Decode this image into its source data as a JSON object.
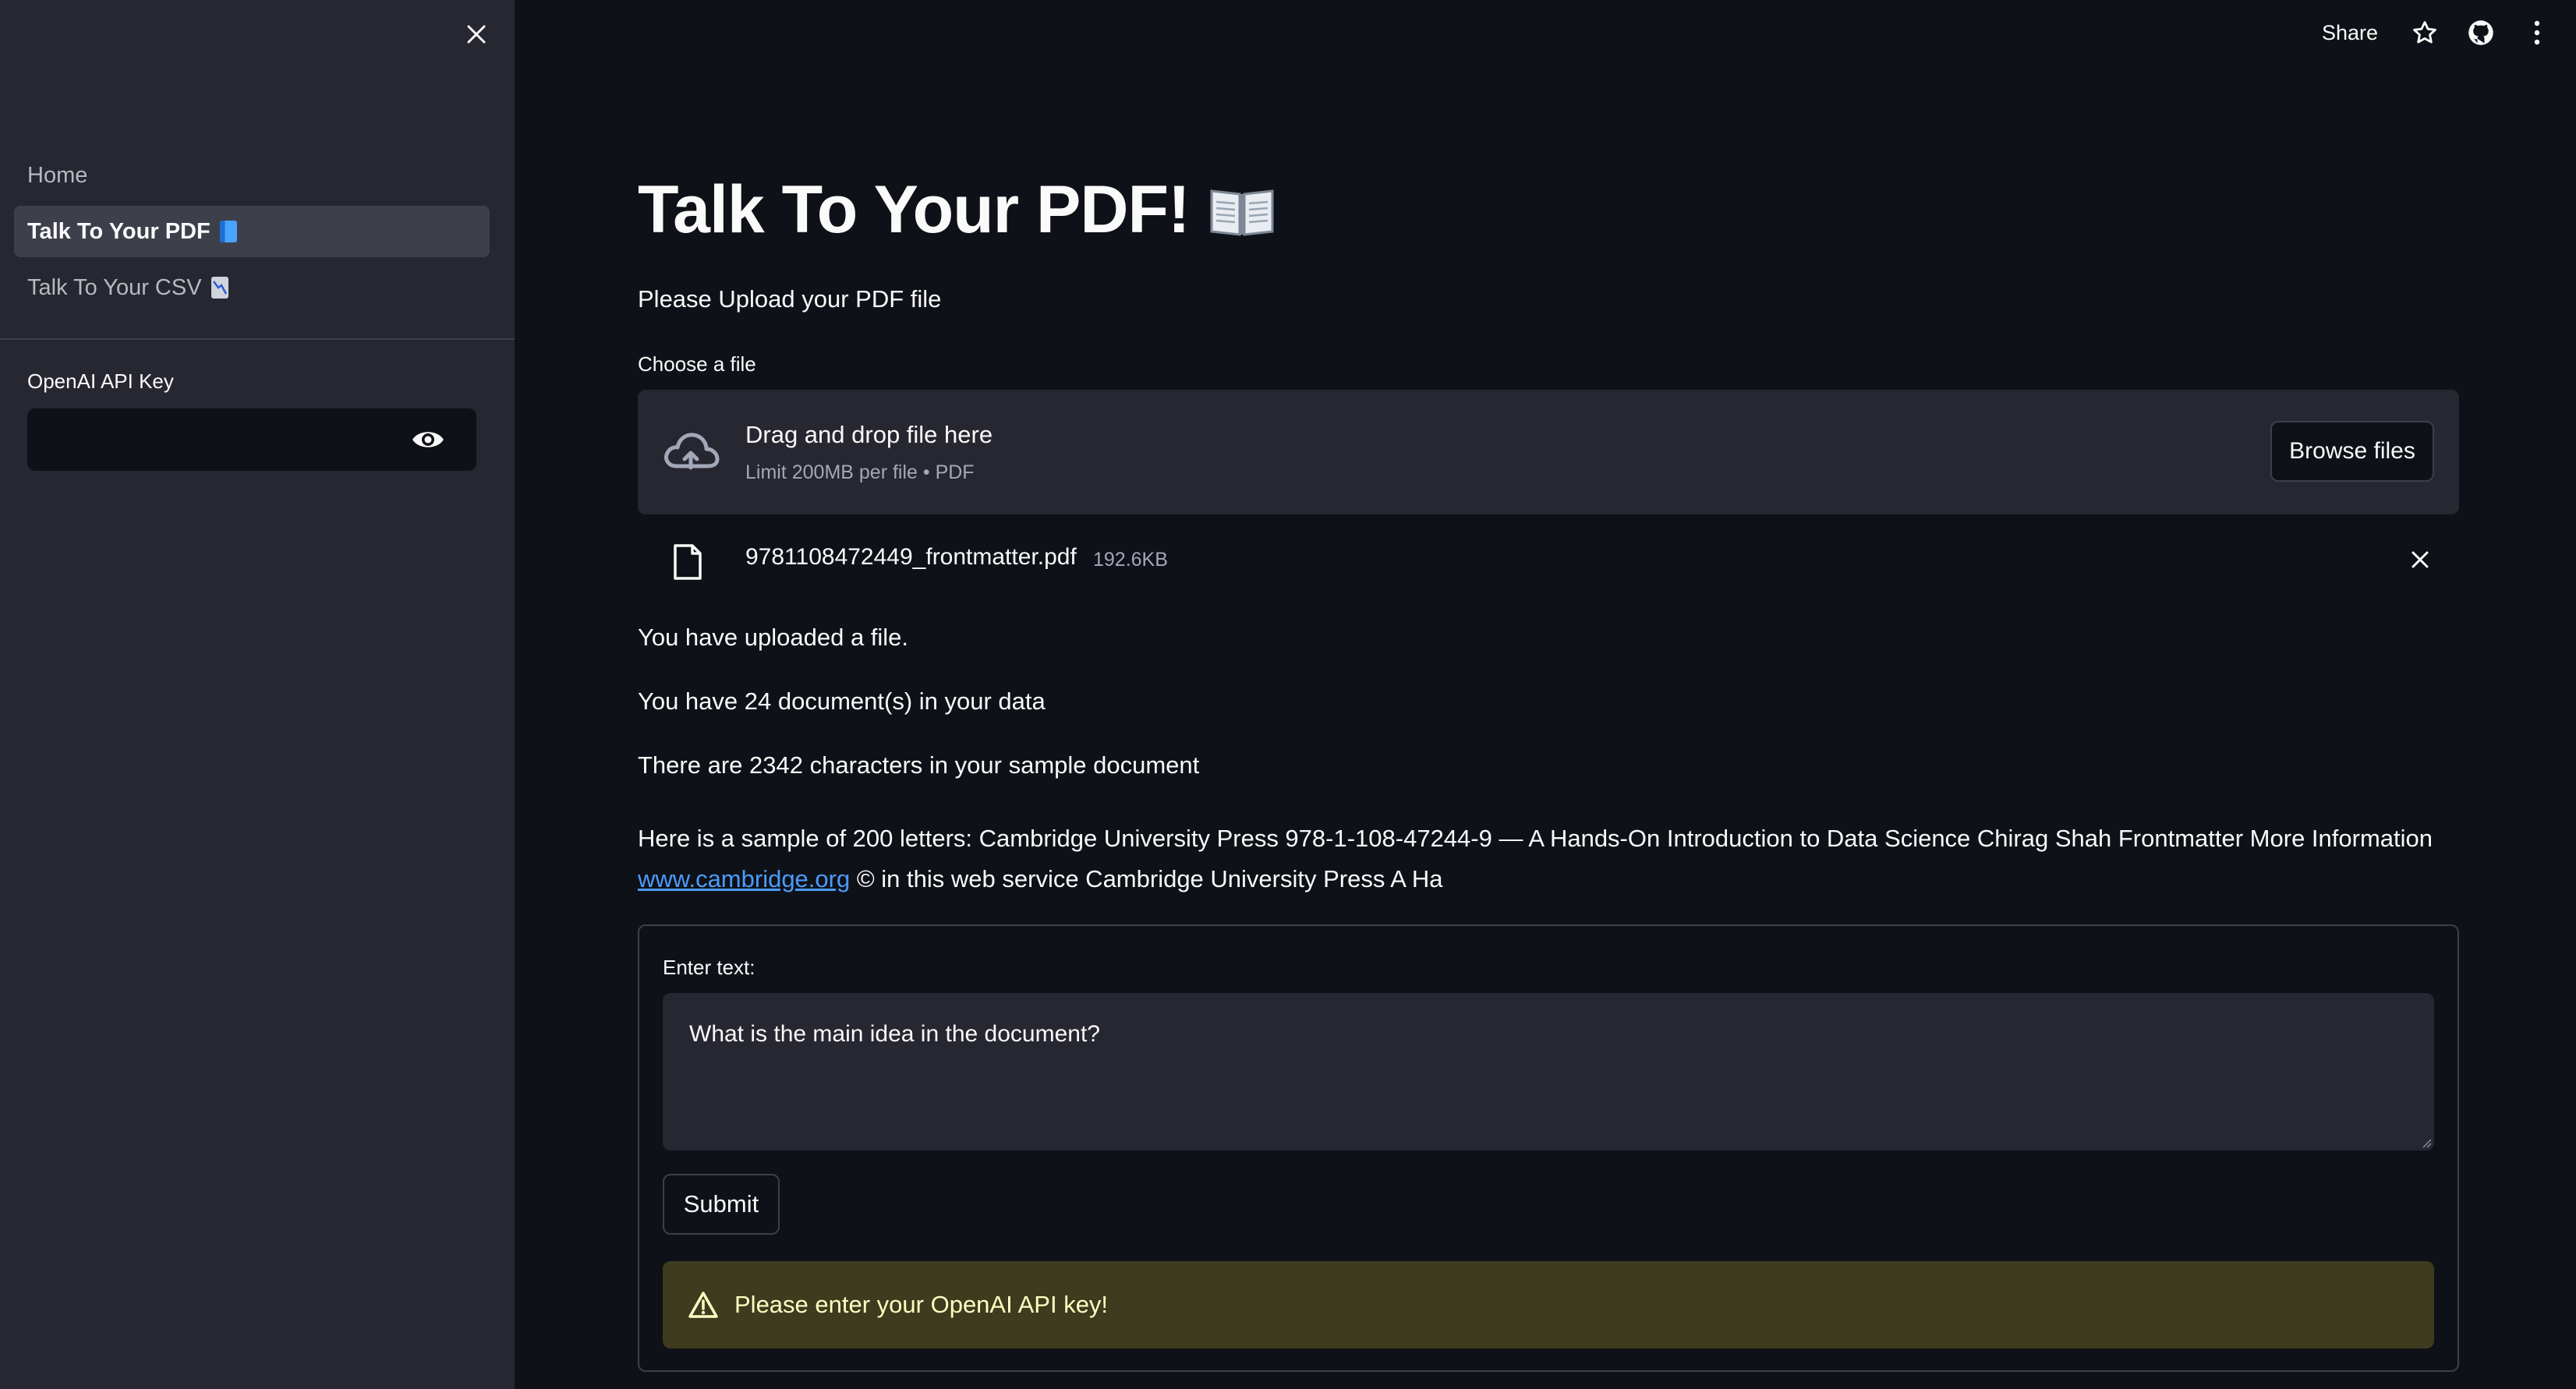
{
  "sidebar": {
    "close_icon": "close-icon",
    "nav_items": [
      {
        "label": "Home",
        "emoji": "",
        "active": false
      },
      {
        "label": "Talk To Your PDF",
        "emoji": "blue-book-emoji",
        "active": true
      },
      {
        "label": "Talk To Your CSV",
        "emoji": "chart-decreasing-emoji",
        "active": false
      }
    ],
    "api_key_label": "OpenAI API Key",
    "api_key_value": "",
    "eye_icon": "eye-icon"
  },
  "header": {
    "share_label": "Share",
    "icons": [
      "star-icon",
      "github-icon",
      "more-vertical-icon"
    ]
  },
  "main": {
    "title": "Talk To Your PDF!",
    "title_emoji": "open-book-emoji",
    "intro": "Please Upload your PDF file",
    "uploader": {
      "label": "Choose a file",
      "drop_title": "Drag and drop file here",
      "drop_sub": "Limit 200MB per file • PDF",
      "browse_label": "Browse files",
      "file_name": "9781108472449_frontmatter.pdf",
      "file_size": "192.6KB"
    },
    "messages": [
      "You have uploaded a file.",
      "You have 24 document(s) in your data",
      "There are 2342 characters in your sample document"
    ],
    "sample_prefix": "Here is a sample of 200 letters: Cambridge University Press 978-1-108-47244-9 — A Hands-On Introduction to Data Science Chirag Shah Frontmatter More Information",
    "sample_link": "www.cambridge.org",
    "sample_suffix": "© in this web service Cambridge University Press A Ha",
    "form": {
      "label": "Enter text:",
      "textarea_value": "What is the main idea in the document?",
      "submit_label": "Submit",
      "warning": "Please enter your OpenAI API key!"
    }
  },
  "colors": {
    "background": "#0e1117",
    "sidebar": "#262730",
    "link": "#4c9bff",
    "warning_bg": "#3e3b1f",
    "warning_text": "#ffffc2"
  }
}
